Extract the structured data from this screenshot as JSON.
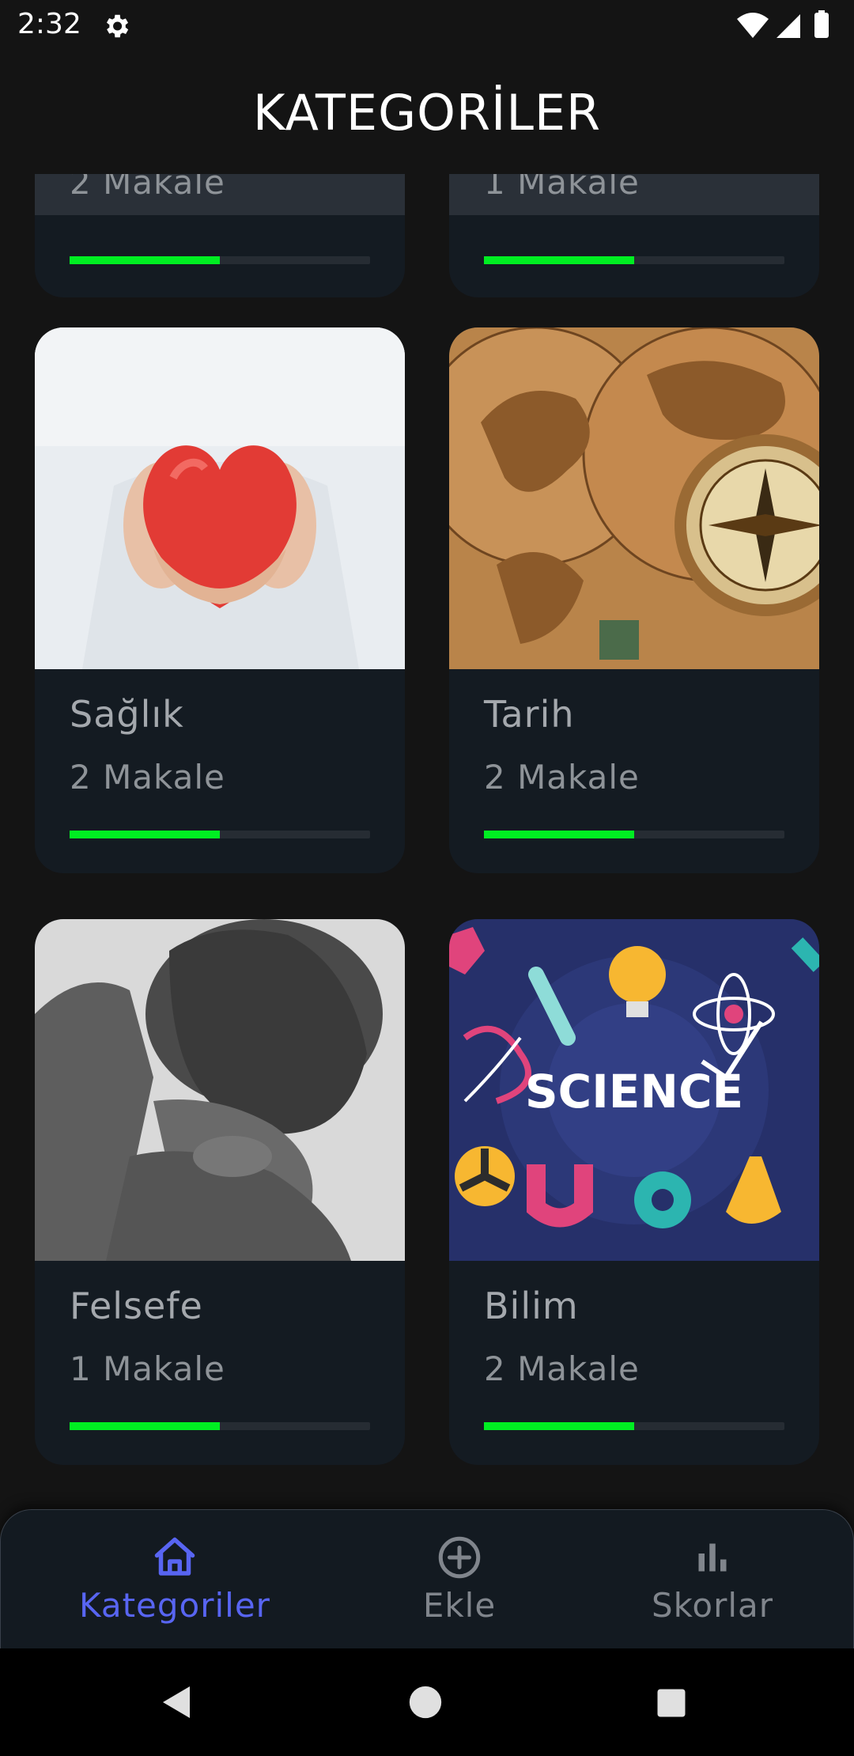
{
  "status_bar": {
    "time": "2:32",
    "icons": [
      "gear-icon",
      "wifi-icon",
      "signal-icon",
      "battery-icon"
    ]
  },
  "header": {
    "title": "KATEGORİLER"
  },
  "categories": [
    {
      "name": "",
      "count": "2 Makale",
      "progress": 0.5,
      "image_icon": ""
    },
    {
      "name": "",
      "count": "1 Makale",
      "progress": 0.5,
      "image_icon": ""
    },
    {
      "name": "Sağlık",
      "count": "2 Makale",
      "progress": 0.5,
      "image_icon": "heart-in-hands-image"
    },
    {
      "name": "Tarih",
      "count": "2 Makale",
      "progress": 0.5,
      "image_icon": "antique-map-compass-image"
    },
    {
      "name": "Felsefe",
      "count": "1 Makale",
      "progress": 0.5,
      "image_icon": "thinker-statue-image"
    },
    {
      "name": "Bilim",
      "count": "2 Makale",
      "progress": 0.5,
      "image_icon": "science-illustration-image",
      "image_text": "SCIENCE"
    }
  ],
  "bottom_nav": {
    "items": [
      {
        "label": "Kategoriler",
        "icon": "home-icon",
        "active": true
      },
      {
        "label": "Ekle",
        "icon": "add-circle-icon",
        "active": false
      },
      {
        "label": "Skorlar",
        "icon": "bar-chart-icon",
        "active": false
      }
    ]
  },
  "colors": {
    "background": "#141414",
    "card": "#141b22",
    "progress_fill": "#00ee22",
    "progress_track": "#262c33",
    "nav_active": "#5865f2",
    "nav_inactive": "#80858c"
  }
}
